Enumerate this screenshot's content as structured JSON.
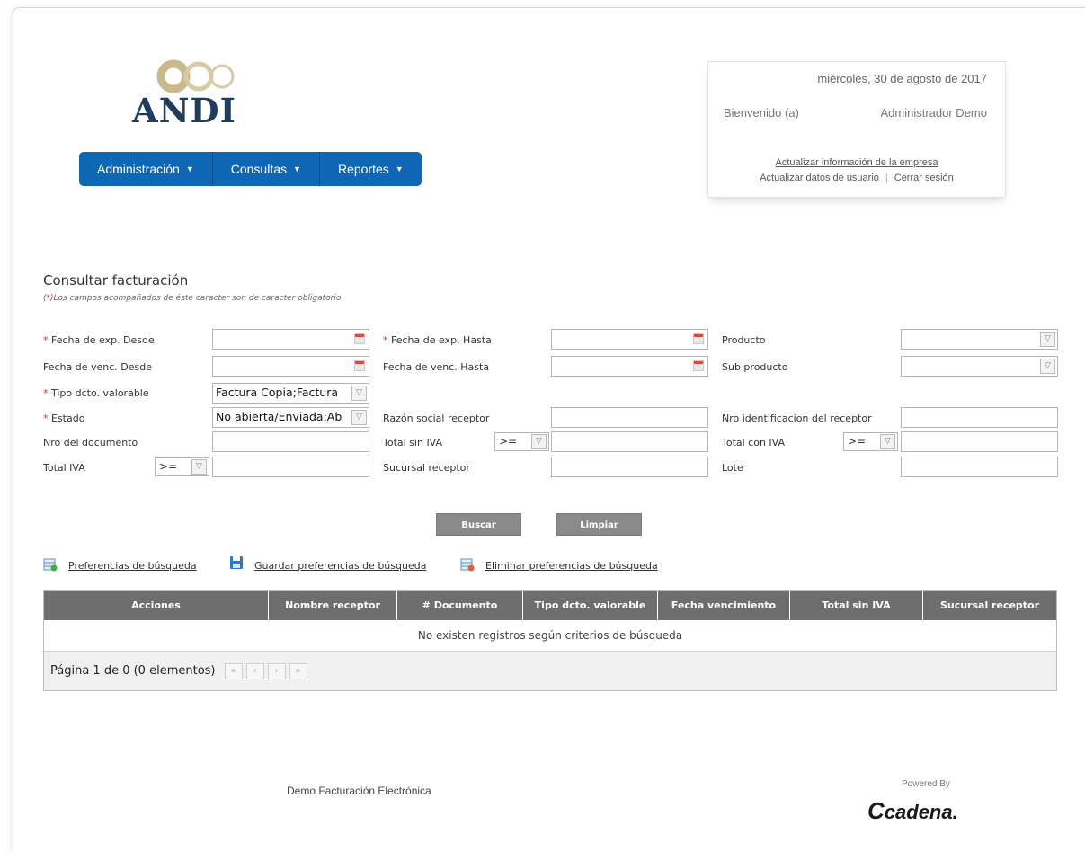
{
  "brand": {
    "logo_text": "ANDI",
    "logo_color": "#1f3d5c",
    "ring_color": "#c9b98a"
  },
  "nav": {
    "items": [
      {
        "label": "Administración"
      },
      {
        "label": "Consultas"
      },
      {
        "label": "Reportes"
      }
    ],
    "color": "#0d67b5"
  },
  "user_box": {
    "date": "miércoles, 30 de agosto de 2017",
    "welcome": "Bienvenido (a)",
    "user": "Administrador Demo",
    "link_company": "Actualizar información de la empresa",
    "link_user": "Actualizar datos de usuario",
    "separator": "|",
    "link_logout": "Cerrar sesión"
  },
  "form": {
    "title": "Consultar facturación",
    "note_mark": "(*)",
    "note": "Los campos acompañados de éste caracter son de caracter obligatorio",
    "required_mark": "*",
    "labels": {
      "fecha_exp_desde": "Fecha de exp. Desde",
      "fecha_exp_hasta": "Fecha de exp. Hasta",
      "producto": "Producto",
      "fecha_venc_desde": "Fecha de venc. Desde",
      "fecha_venc_hasta": "Fecha de venc. Hasta",
      "sub_producto": "Sub producto",
      "tipo_dcto": "Tipo dcto. valorable",
      "estado": "Estado",
      "razon_social": "Razón social receptor",
      "nro_identificacion": "Nro identificacion del receptor",
      "nro_documento": "Nro del documento",
      "total_sin_iva": "Total sin IVA",
      "total_con_iva": "Total con IVA",
      "total_iva": "Total IVA",
      "sucursal_receptor": "Sucursal receptor",
      "lote": "Lote"
    },
    "values": {
      "tipo_dcto": "Factura Copia;Factura",
      "estado": "No abierta/Enviada;Ab",
      "operator": ">="
    },
    "buttons": {
      "search": "Buscar",
      "clear": "Limpiar"
    }
  },
  "preferences": {
    "search_prefs": "Preferencias de búsqueda",
    "save_prefs": "Guardar preferencias de búsqueda",
    "delete_prefs": "Eliminar preferencias de búsqueda"
  },
  "table": {
    "columns": [
      "Acciones",
      "Nombre receptor",
      "# Documento",
      "Tipo dcto. valorable",
      "Fecha vencimiento",
      "Total sin IVA",
      "Sucursal receptor"
    ],
    "empty_message": "No existen registros según criterios de búsqueda",
    "pagination": "Página 1 de 0 (0 elementos)",
    "pager_buttons": [
      "«",
      "‹",
      "›",
      "»"
    ]
  },
  "footer": {
    "text": "Demo Facturación Electrónica",
    "powered_by": "Powered By",
    "cadena": "cadena."
  }
}
